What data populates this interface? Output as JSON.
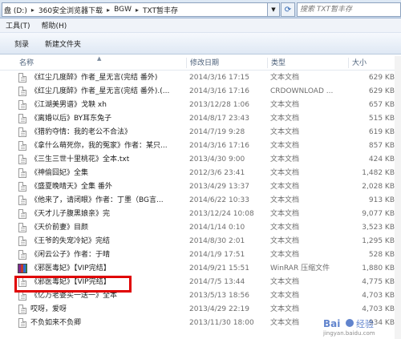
{
  "address": {
    "crumbs": [
      "盘 (D:)",
      "360安全浏览器下载",
      "BGW",
      "TXT暂丰存"
    ],
    "separator": "▸",
    "dropdown_icon": "chevron-down-icon",
    "refresh_icon": "refresh-icon"
  },
  "search": {
    "placeholder": "搜索 TXT暂丰存"
  },
  "menu": {
    "tools": "工具(T)",
    "help": "帮助(H)"
  },
  "toolbar": {
    "burn": "刻录",
    "new_folder": "新建文件夹"
  },
  "columns": {
    "name": "名称",
    "date": "修改日期",
    "type": "类型",
    "size": "大小"
  },
  "files": [
    {
      "name": "《红尘几度醉》作者_星无言(完结 番外)",
      "date": "2014/3/16 17:15",
      "type": "文本文档",
      "size": "629 KB"
    },
    {
      "name": "《红尘几度醉》作者_星无言(完结 番外).(...",
      "date": "2014/3/16 17:16",
      "type": "CRDOWNLOAD ...",
      "size": "629 KB"
    },
    {
      "name": "《江湖美男谱》戈鞅 xh",
      "date": "2013/12/28 1:06",
      "type": "文本文档",
      "size": "657 KB"
    },
    {
      "name": "《离婚以后》BY耳东兔子",
      "date": "2014/8/17 23:43",
      "type": "文本文档",
      "size": "515 KB"
    },
    {
      "name": "《猎豹夺情：我的老公不合法》",
      "date": "2014/7/19 9:28",
      "type": "文本文档",
      "size": "619 KB"
    },
    {
      "name": "《拿什么萌死你，我的冤家》作者：某只...",
      "date": "2014/3/16 17:16",
      "type": "文本文档",
      "size": "857 KB"
    },
    {
      "name": "《三生三世十里桃花》全本.txt",
      "date": "2013/4/30 9:00",
      "type": "文本文档",
      "size": "424 KB"
    },
    {
      "name": "《神偷囧妃》全集",
      "date": "2012/3/6 23:41",
      "type": "文本文档",
      "size": "1,482 KB"
    },
    {
      "name": "《盛夏晚晴天》全集 番外",
      "date": "2013/4/29 13:37",
      "type": "文本文档",
      "size": "2,028 KB"
    },
    {
      "name": "《他来了，请闭眼》作者：丁墨（BG言...",
      "date": "2014/6/22 10:33",
      "type": "文本文档",
      "size": "913 KB"
    },
    {
      "name": "《天才儿子腹黑娘亲》完",
      "date": "2013/12/24 10:08",
      "type": "文本文档",
      "size": "9,077 KB"
    },
    {
      "name": "《天价前妻》目颜",
      "date": "2014/1/14 0:10",
      "type": "文本文档",
      "size": "3,523 KB"
    },
    {
      "name": "《王爷的失宠冷妃》完结",
      "date": "2014/8/30 2:01",
      "type": "文本文档",
      "size": "1,295 KB"
    },
    {
      "name": "《闲云公子》作者：于晴",
      "date": "2014/1/9 17:51",
      "type": "文本文档",
      "size": "528 KB"
    },
    {
      "name": "《邪医毒妃》【VIP完结】",
      "date": "2014/9/21 15:51",
      "type": "WinRAR 压缩文件",
      "size": "1,880 KB",
      "icon": "rar"
    },
    {
      "name": "《邪医毒妃》【VIP完结】",
      "date": "2014/7/5 13:44",
      "type": "文本文档",
      "size": "4,775 KB"
    },
    {
      "name": "《亿万老婆买一送一》全本",
      "date": "2013/5/13 18:56",
      "type": "文本文档",
      "size": "4,703 KB"
    },
    {
      "name": "哎呀，爱呀",
      "date": "2013/4/29 22:19",
      "type": "文本文档",
      "size": "4,703 KB"
    },
    {
      "name": "不负如来不负卿",
      "date": "2013/11/30 18:00",
      "type": "文本文档",
      "size": "934 KB"
    }
  ],
  "watermark": {
    "text": "Bai 经验",
    "sub": "jingyan.baidu.com"
  },
  "colors": {
    "highlight": "#e00000",
    "chrome": "#dfe9f5",
    "header_text": "#4c607a"
  }
}
